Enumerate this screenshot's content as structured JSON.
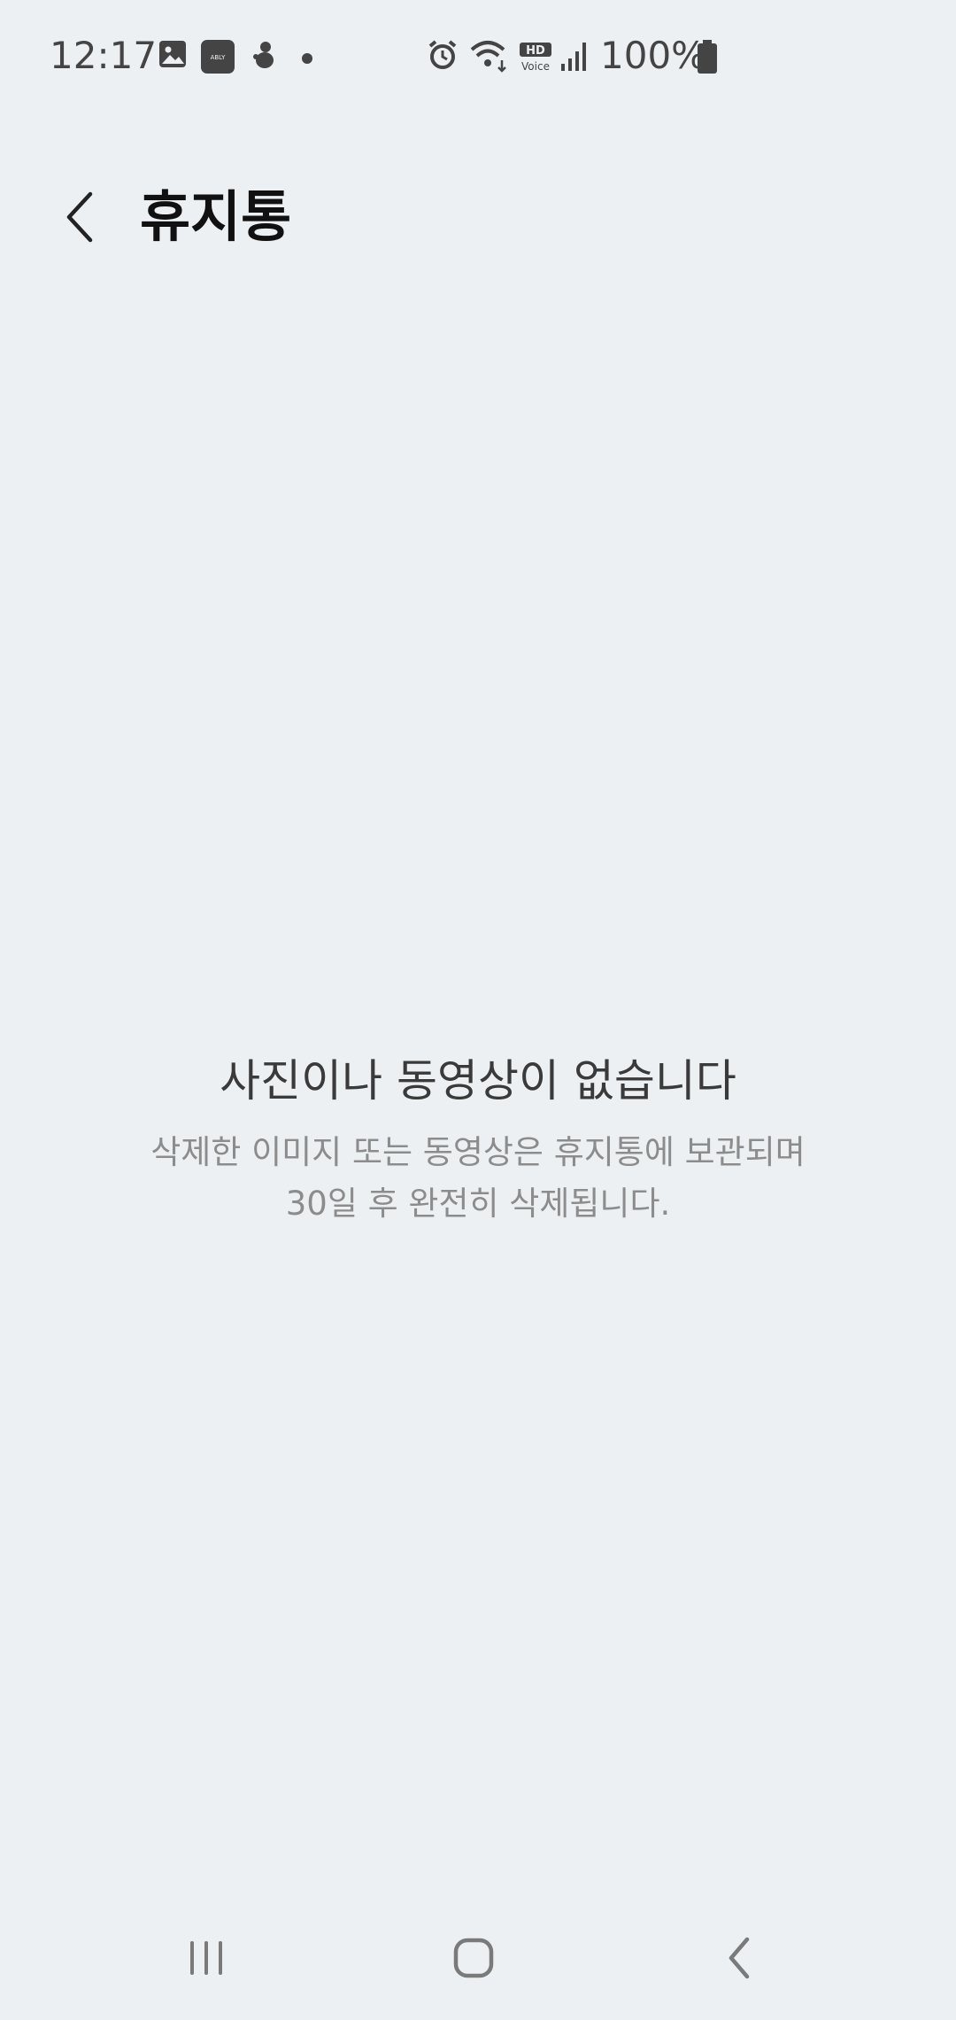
{
  "status_bar": {
    "time": "12:17",
    "notification_icons": [
      "gallery-icon",
      "ably-app-icon",
      "app-mascot-icon",
      "dot-icon"
    ],
    "ably_label": "ABLY",
    "system_icons": [
      "alarm-icon",
      "wifi-icon",
      "hd-voice-icon",
      "signal-icon",
      "battery-icon"
    ],
    "hd_label": "HD",
    "voice_label": "Voice",
    "battery_percent": "100%"
  },
  "header": {
    "title": "휴지통",
    "back_icon": "chevron-left-icon"
  },
  "empty_state": {
    "title": "사진이나 동영상이 없습니다",
    "description_line1": "삭제한 이미지 또는 동영상은 휴지통에 보관되며",
    "description_line2": "30일 후 완전히 삭제됩니다."
  },
  "nav_bar": {
    "recents_icon": "recents-icon",
    "home_icon": "home-icon",
    "back_icon": "back-icon"
  },
  "colors": {
    "background": "#edf0f3",
    "title_text": "#111111",
    "body_text": "#3a3a3a",
    "secondary_text": "#8c8c8c"
  }
}
